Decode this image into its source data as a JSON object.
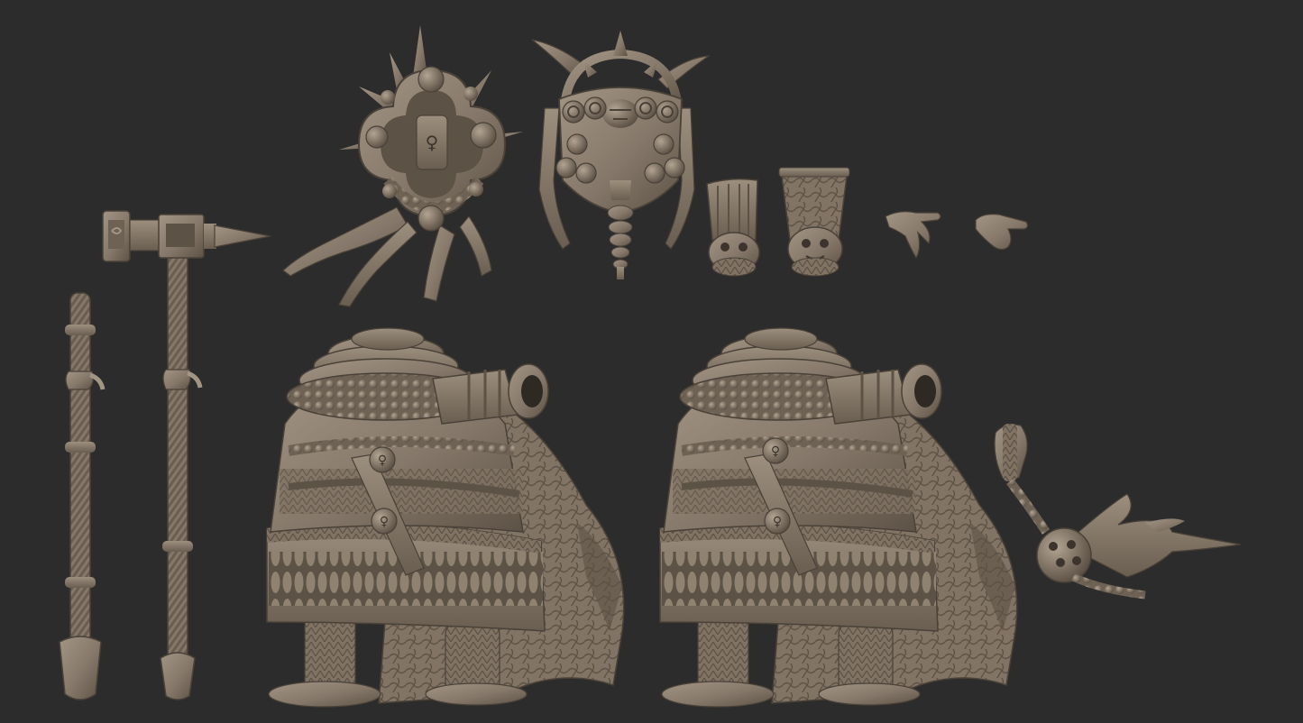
{
  "scene": {
    "description_note": "",
    "colors": {
      "background": "#2c2c2c",
      "clay": "#8a7c6c",
      "clay_light": "#a39584",
      "clay_dark": "#5d5246",
      "clay_shadow": "#463d34"
    },
    "parts": [
      "hammer-weapon",
      "staff-weapon",
      "star-medallion-backpack",
      "skull-horn-backpack",
      "head-variant-plain",
      "head-variant-ornate",
      "hand-open",
      "hand-pointing",
      "body-variant-left",
      "body-variant-right",
      "flail-weapon"
    ]
  }
}
